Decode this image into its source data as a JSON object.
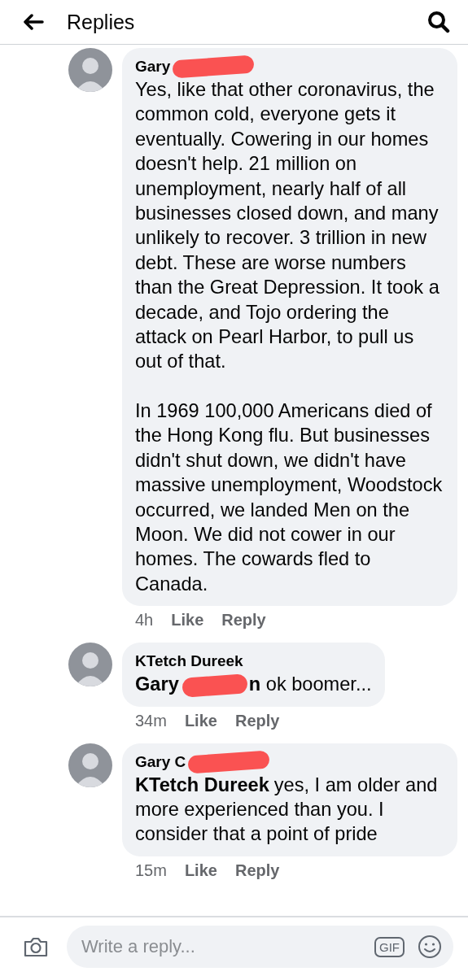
{
  "header": {
    "title": "Replies"
  },
  "comments": [
    {
      "author": "Gary",
      "author_redacted": true,
      "paragraphs": [
        "Yes, like that other coronavirus, the common cold, everyone gets it eventually. Cowering in our homes doesn't help. 21 million on unemployment, nearly half of all businesses closed down, and many unlikely to recover. 3 trillion in new debt. These are worse numbers than the Great Depression. It took a decade, and Tojo ordering the attack on Pearl Harbor, to pull us out of that.",
        "In 1969 100,000 Americans died of the Hong Kong flu. But businesses didn't shut down, we didn't have massive unemployment, Woodstock occurred, we landed Men on the Moon. We did not cower in our homes. The cowards fled to Canada."
      ],
      "time": "4h",
      "like": "Like",
      "reply": "Reply"
    },
    {
      "author": "KTetch Dureek",
      "author_redacted": false,
      "mention": "Gary",
      "mention_redacted": true,
      "paragraphs": [
        "**n** ok boomer..."
      ],
      "time": "34m",
      "like": "Like",
      "reply": "Reply"
    },
    {
      "author": "Gary C",
      "author_redacted": true,
      "mention": "KTetch Dureek",
      "mention_redacted": false,
      "paragraphs": [
        "yes, I am older and more experienced than you. I consider that a point of pride"
      ],
      "time": "15m",
      "like": "Like",
      "reply": "Reply"
    }
  ],
  "composer": {
    "placeholder": "Write a reply...",
    "gif": "GIF"
  }
}
